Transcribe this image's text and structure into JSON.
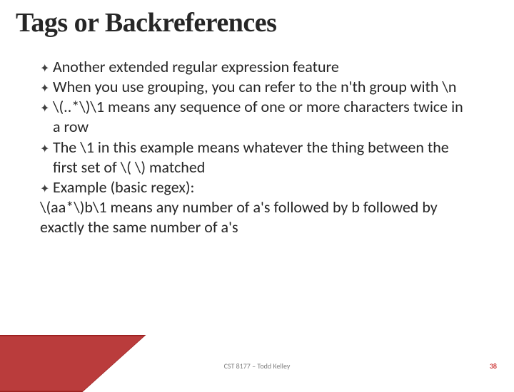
{
  "title": "Tags or Backreferences",
  "bullets": {
    "b0": "Another extended regular expression feature",
    "b1": "When you use grouping, you can refer to the n'th group with \\n",
    "b2": "\\(..*\\)\\1 means any sequence of one or more characters twice in a row",
    "b3": "The \\1 in this example means whatever the thing between the first set of \\(  \\) matched",
    "b4": "Example (basic regex):"
  },
  "continuation": "\\(aa*\\)b\\1 means any number of a's followed by b followed by exactly the same number of a's",
  "footer": {
    "center": "CST 8177 – Todd Kelley",
    "page": "38"
  }
}
